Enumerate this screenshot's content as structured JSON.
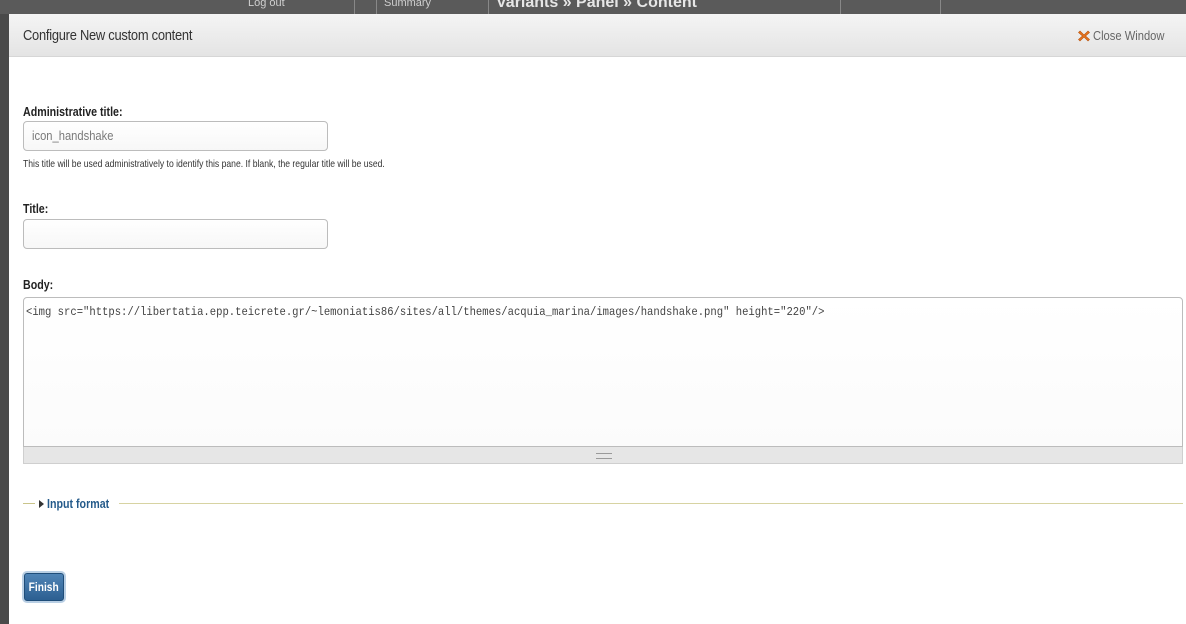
{
  "background": {
    "items": [
      "Log out",
      "Summary",
      "Variants » Panel » Content"
    ]
  },
  "modal": {
    "title": "Configure New custom content",
    "close_label": "Close Window"
  },
  "form": {
    "admin_title": {
      "label": "Administrative title:",
      "value": "icon_handshake",
      "description": "This title will be used administratively to identify this pane. If blank, the regular title will be used."
    },
    "title": {
      "label": "Title:",
      "value": ""
    },
    "body": {
      "label": "Body:",
      "value": "<img src=\"https://libertatia.epp.teicrete.gr/~lemoniatis86/sites/all/themes/acquia_marina/images/handshake.png\" height=\"220\"/>"
    },
    "input_format": {
      "label": "Input format",
      "collapsed": true
    },
    "finish_label": "Finish"
  },
  "colors": {
    "finish_button": "#2c5f91",
    "legend_link": "#245a8a",
    "close_icon": "#e8741f"
  },
  "icons": {
    "close": "close-x-icon",
    "collapse": "triangle-right-icon"
  }
}
